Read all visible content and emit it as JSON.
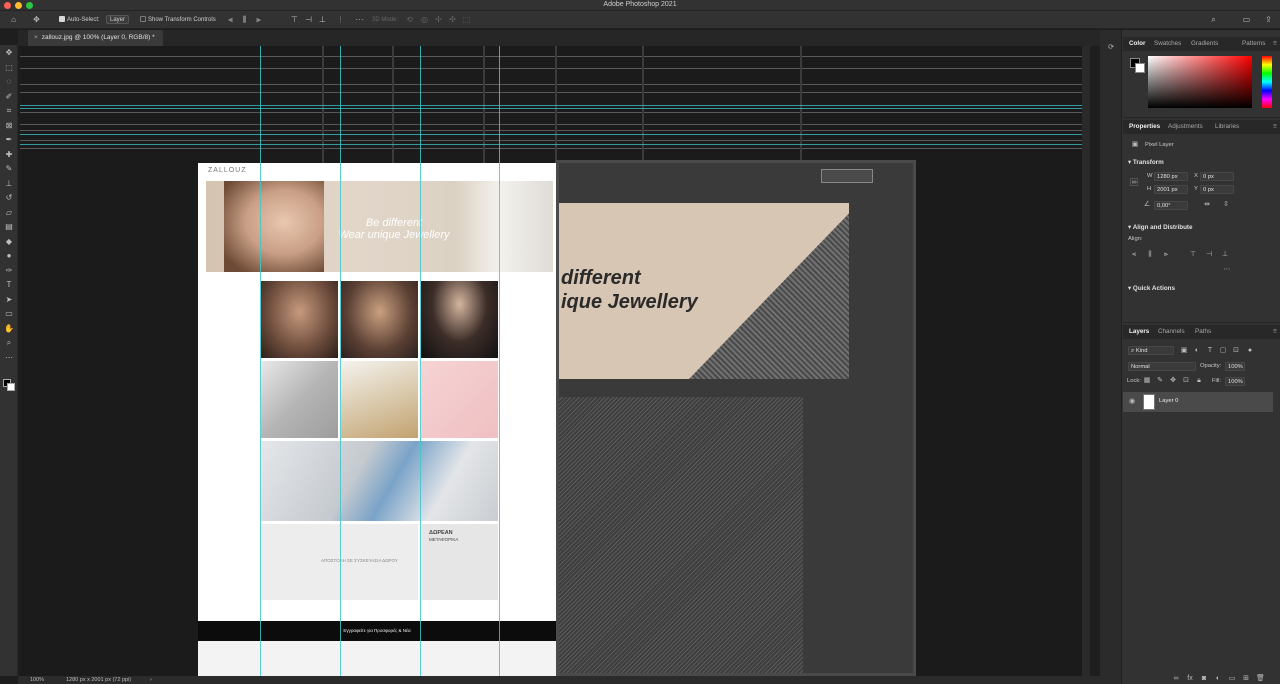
{
  "window": {
    "title": "Adobe Photoshop 2021"
  },
  "options_bar": {
    "auto_select_label": "Auto-Select:",
    "auto_select_value": "Layer",
    "transform_controls_label": "Show Transform Controls",
    "mode_3d_label": "3D Mode:",
    "more_label": "···"
  },
  "document": {
    "tab_label": "zallouz.jpg @ 100% (Layer 0, RGB/8) *",
    "close_glyph": "×"
  },
  "canvas_content": {
    "logo_text": "ZALLOUZ",
    "hero_line1": "Be different",
    "hero_line2": "Wear unique Jewellery",
    "gift_text": "ΑΠΟΣΤΟΛΗ ΣΕ ΣΥΣΚΕΥΑΣΙΑ ΔΩΡΟΥ",
    "shipping_title": "ΔΩΡΕΑΝ",
    "shipping_sub": "ΜΕΤΑΦΟΡΙΚΑ",
    "newsletter_text": "Εγγραφείτε για Προσφορές & Νέα",
    "pixel_text_1": "different",
    "pixel_text_2": "ique Jewellery"
  },
  "panels": {
    "color_tabs": [
      "Color",
      "Swatches",
      "Gradients",
      "Patterns"
    ],
    "props_tabs": [
      "Properties",
      "Adjustments",
      "Libraries"
    ],
    "pixel_layer_label": "Pixel Layer",
    "transform_title": "Transform",
    "w_label": "W",
    "w_value": "1280 px",
    "h_label": "H",
    "h_value": "2001 px",
    "x_label": "X",
    "x_value": "0 px",
    "y_label": "Y",
    "y_value": "0 px",
    "angle_value": "0,00°",
    "align_title": "Align and Distribute",
    "align_label": "Align:",
    "quick_actions_title": "Quick Actions",
    "layers_tabs": [
      "Layers",
      "Channels",
      "Paths"
    ],
    "kind_label": "Kind",
    "blend_mode": "Normal",
    "opacity_label": "Opacity:",
    "opacity_value": "100%",
    "lock_label": "Lock:",
    "fill_label": "Fill:",
    "fill_value": "100%",
    "layer_name": "Layer 0"
  },
  "status_bar": {
    "zoom": "100%",
    "doc_info": "1280 px x 2001 px (72 ppi)",
    "arrow": "›"
  },
  "colors": {
    "guide": "#3fc6cc",
    "ui_bg": "#323232",
    "canvas_bg": "#1b1b1b"
  },
  "icons": {
    "tools": [
      "move-icon",
      "marquee-icon",
      "lasso-icon",
      "quick-select-icon",
      "crop-icon",
      "frame-icon",
      "eyedropper-icon",
      "healing-icon",
      "brush-icon",
      "stamp-icon",
      "history-brush-icon",
      "eraser-icon",
      "gradient-icon",
      "blur-icon",
      "dodge-icon",
      "pen-icon",
      "type-icon",
      "path-select-icon",
      "shape-icon",
      "hand-icon",
      "zoom-icon",
      "more-tools-icon"
    ]
  }
}
